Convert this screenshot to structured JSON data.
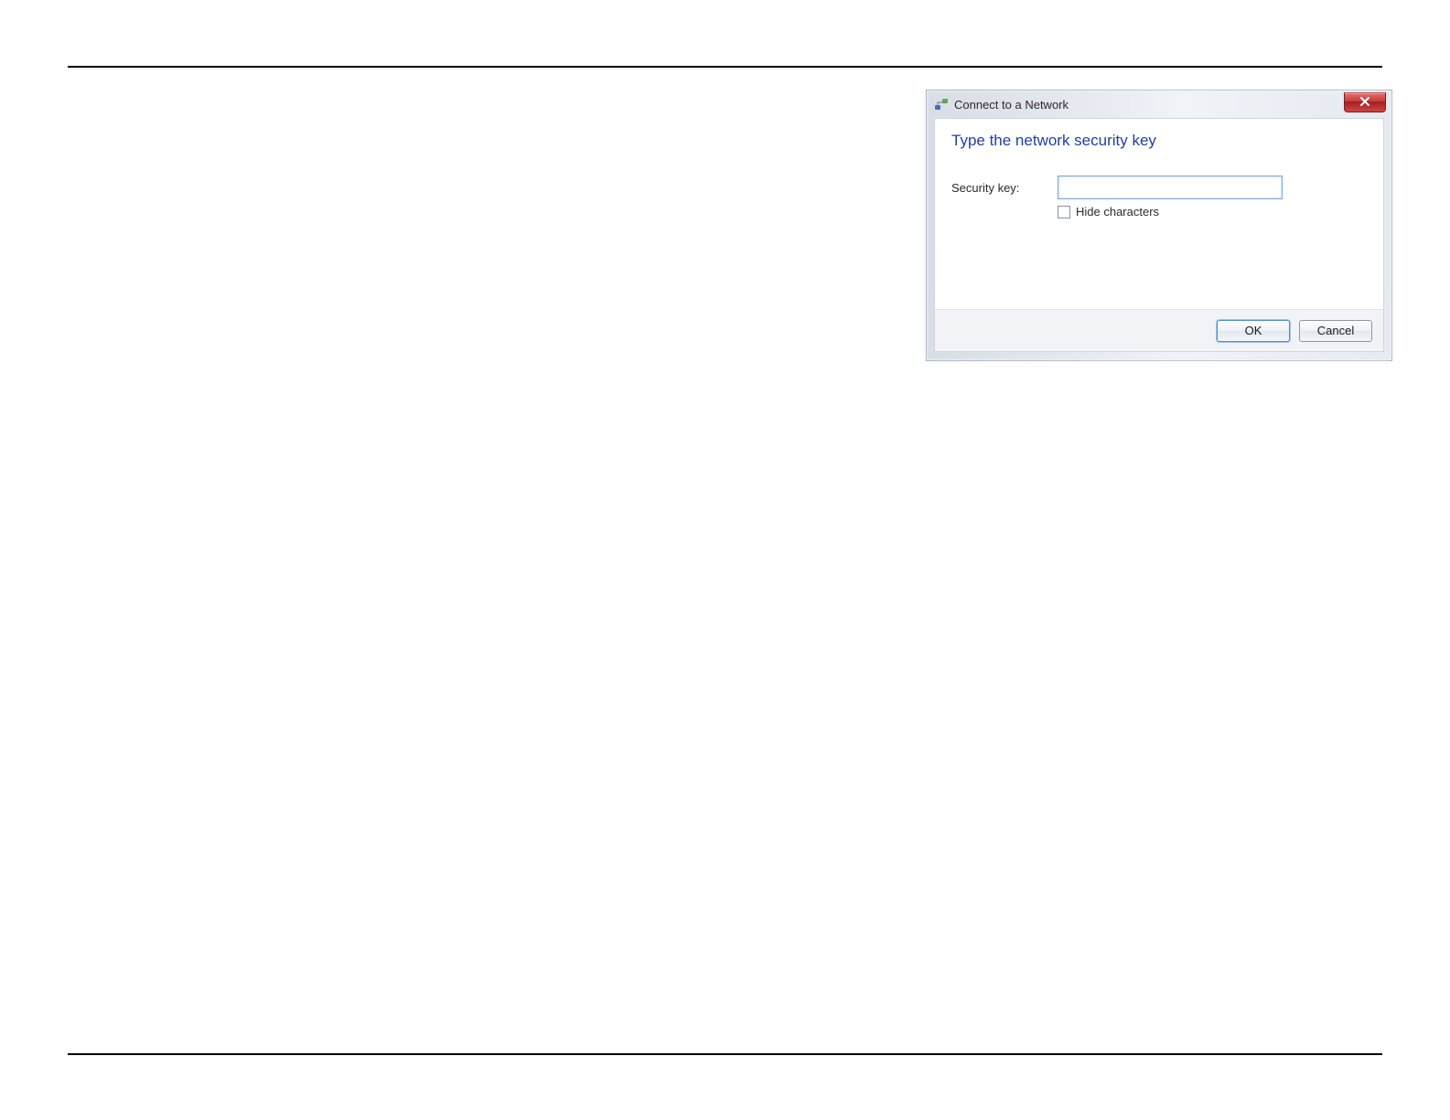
{
  "dialog": {
    "title": "Connect to a Network",
    "heading": "Type the network security key",
    "field_label": "Security key:",
    "input_value": "",
    "hide_characters_label": "Hide characters",
    "buttons": {
      "ok": "OK",
      "cancel": "Cancel"
    }
  }
}
